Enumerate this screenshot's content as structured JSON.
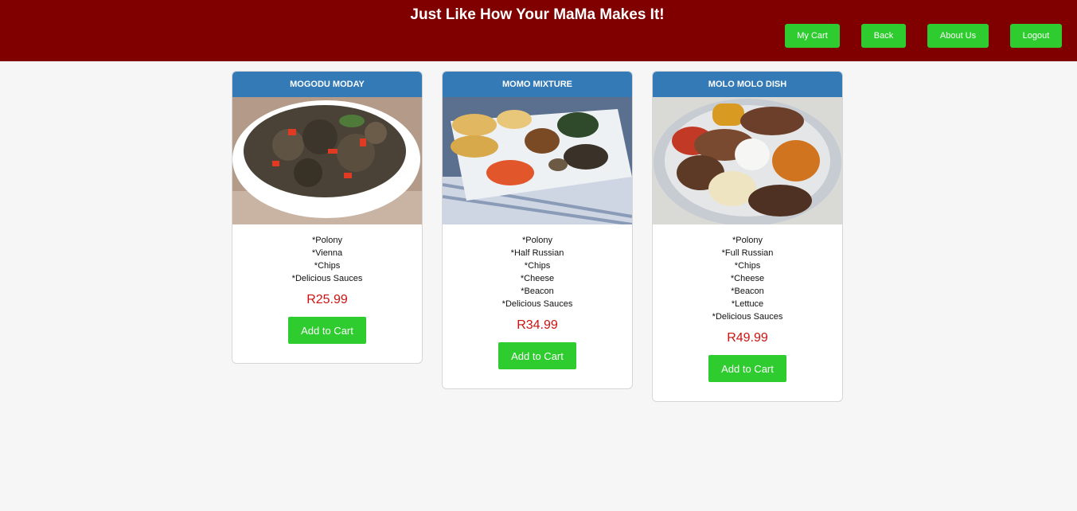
{
  "header": {
    "title": "Just Like How Your MaMa Makes It!",
    "nav": {
      "my_cart": "My Cart",
      "back": "Back",
      "about_us": "About Us",
      "logout": "Logout"
    }
  },
  "colors": {
    "header_bg": "#800000",
    "button_green": "#2ecc2e",
    "card_header_blue": "#337ab7",
    "price_red": "#cc1111"
  },
  "products": [
    {
      "name": "MOGODU MODAY",
      "image": "mogodu-dish-image",
      "ingredients": [
        "*Polony",
        "*Vienna",
        "*Chips",
        "*Delicious Sauces"
      ],
      "price": "R25.99",
      "button": "Add to Cart"
    },
    {
      "name": "MOMO MIXTURE",
      "image": "momo-mixture-platter-image",
      "ingredients": [
        "*Polony",
        "*Half Russian",
        "*Chips",
        "*Cheese",
        "*Beacon",
        "*Delicious Sauces"
      ],
      "price": "R34.99",
      "button": "Add to Cart"
    },
    {
      "name": "MOLO MOLO DISH",
      "image": "molo-molo-grill-plate-image",
      "ingredients": [
        "*Polony",
        "*Full Russian",
        "*Chips",
        "*Cheese",
        "*Beacon",
        "*Lettuce",
        "*Delicious Sauces"
      ],
      "price": "R49.99",
      "button": "Add to Cart"
    }
  ]
}
